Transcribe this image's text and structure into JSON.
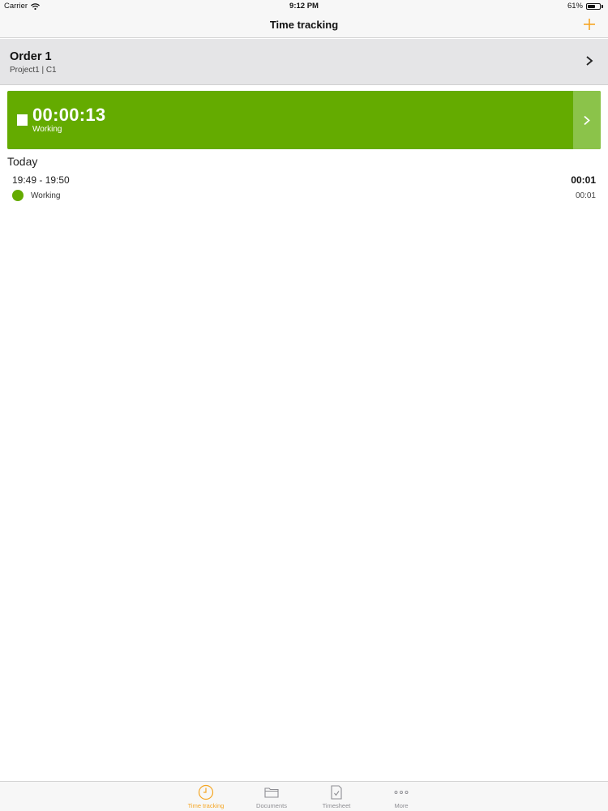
{
  "status_bar": {
    "carrier": "Carrier",
    "time": "9:12 PM",
    "battery": "61%",
    "battery_level": 0.61
  },
  "nav": {
    "title": "Time tracking",
    "add_icon": "plus-icon"
  },
  "order": {
    "title": "Order 1",
    "subtitle": "Project1 | C1"
  },
  "timer": {
    "value": "00:00:13",
    "label": "Working",
    "color": "#64ab00",
    "side_color": "#8bc34a"
  },
  "today": {
    "heading": "Today",
    "entries": [
      {
        "range": "19:49 - 19:50",
        "total": "00:01",
        "activity": "Working",
        "duration": "00:01",
        "color": "#64ab00"
      }
    ]
  },
  "tabs": [
    {
      "label": "Time tracking",
      "icon": "clock-icon",
      "active": true
    },
    {
      "label": "Documents",
      "icon": "folder-icon",
      "active": false
    },
    {
      "label": "Timesheet",
      "icon": "timesheet-icon",
      "active": false
    },
    {
      "label": "More",
      "icon": "more-icon",
      "active": false
    }
  ],
  "accent_color": "#f5a623"
}
